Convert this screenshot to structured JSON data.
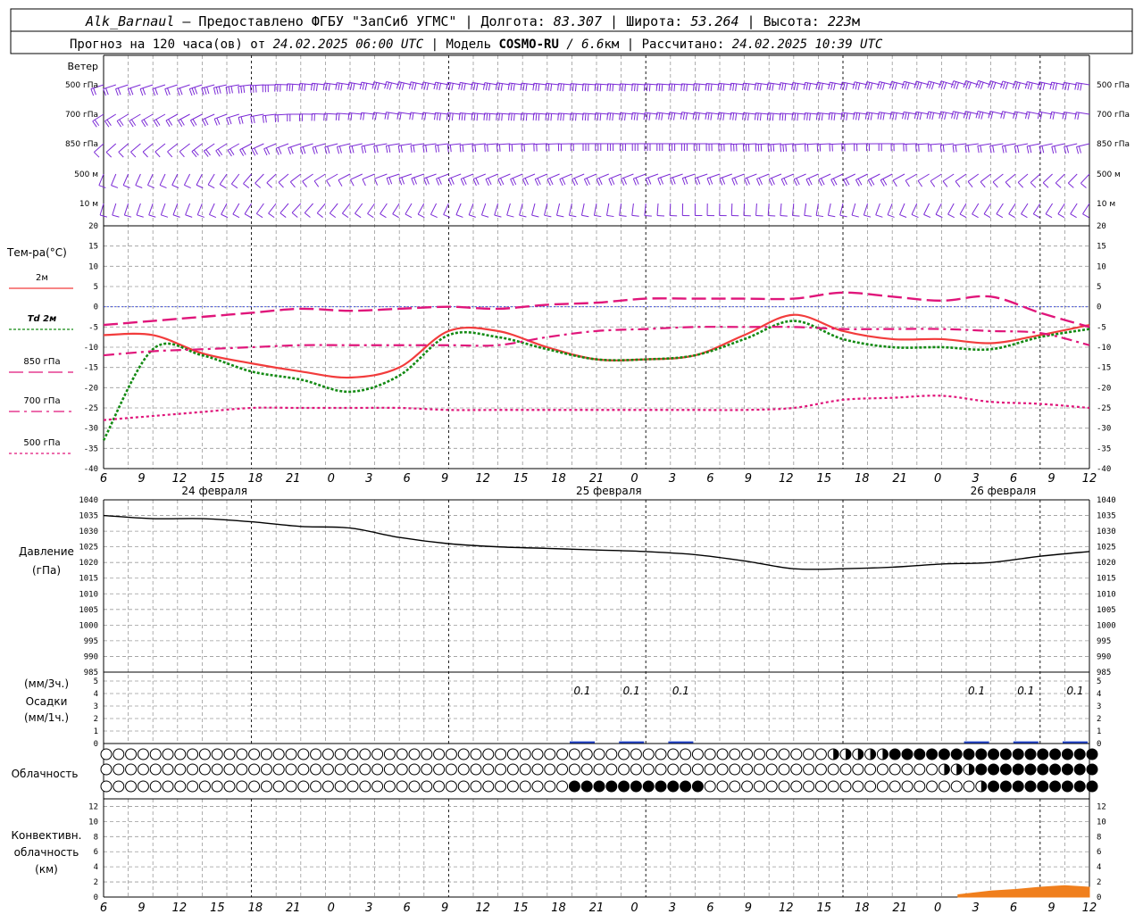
{
  "header": {
    "station": "Alk_Barnaul",
    "provider": " — Предоставлено ФГБУ \"ЗапСиб УГМС\" | Долгота: ",
    "lon": "83.307",
    "lat_label": " | Широта: ",
    "lat": "53.264",
    "alt_label": " | Высота: ",
    "alt": "223",
    "alt_unit": "м",
    "line2_a": "Прогноз на 120 часа(ов) от ",
    "forecast_start": "24.02.2025 06:00 UTC",
    "line2_b": " | Модель ",
    "model": "COSMO-RU",
    "model_res": " / 6.6",
    "model_res_unit": "км",
    "line2_c": " | Рассчитано: ",
    "calc_time": "24.02.2025 10:39 UTC"
  },
  "labels": {
    "wind": "Ветер",
    "wind_levels": [
      "500 гПа",
      "700 гПа",
      "850 гПа",
      "500 м",
      "10 м"
    ],
    "temp_title": "Тем-ра(°C)",
    "temp_legend": [
      "2м",
      "Td 2м",
      "850 гПа",
      "700 гПа",
      "500 гПа"
    ],
    "pressure_title": "Давление",
    "pressure_unit": "(гПа)",
    "precip_top": "(мм/3ч.)",
    "precip_title": "Осадки",
    "precip_bottom": "(мм/1ч.)",
    "cloud_title": "Облачность",
    "conv_title": [
      "Конвективн.",
      "облачность",
      "(км)"
    ]
  },
  "colors": {
    "wind": "#7b2ad6",
    "t2m": "#f23c3c",
    "td2m": "#138a13",
    "t850": "#e0157a",
    "t700": "#e0157a",
    "t500": "#e0157a",
    "pressure": "#000000",
    "precip": "#2244cc",
    "conv": "#f07f1d",
    "zero_line": "#3344dd"
  },
  "chart_data": [
    {
      "type": "wind_barbs",
      "levels": [
        "500 гПа",
        "700 гПа",
        "850 гПа",
        "500 м",
        "10 м"
      ],
      "x_hours": [
        0,
        12,
        24,
        36,
        48,
        60,
        72,
        84,
        96,
        108,
        120
      ],
      "direction_deg": [
        [
          250,
          250,
          275,
          285,
          280,
          275,
          275,
          280,
          285,
          290,
          280
        ],
        [
          235,
          240,
          270,
          280,
          275,
          275,
          280,
          275,
          280,
          285,
          280
        ],
        [
          225,
          230,
          250,
          260,
          265,
          270,
          270,
          265,
          270,
          260,
          255
        ],
        [
          200,
          205,
          230,
          250,
          245,
          245,
          250,
          245,
          240,
          230,
          220
        ],
        [
          195,
          200,
          220,
          210,
          195,
          190,
          180,
          185,
          200,
          210,
          210
        ]
      ],
      "speed_ms": [
        [
          18,
          20,
          22,
          25,
          28,
          28,
          30,
          30,
          28,
          26,
          24
        ],
        [
          12,
          14,
          16,
          18,
          22,
          24,
          26,
          24,
          22,
          20,
          18
        ],
        [
          10,
          12,
          14,
          16,
          18,
          20,
          22,
          20,
          18,
          16,
          14
        ],
        [
          8,
          9,
          10,
          12,
          14,
          16,
          16,
          14,
          12,
          10,
          9
        ],
        [
          4,
          5,
          5,
          6,
          6,
          7,
          7,
          6,
          5,
          5,
          4
        ]
      ]
    },
    {
      "type": "line",
      "title": "Тем-ра(°C)",
      "ylim": [
        -40,
        20
      ],
      "yticks": [
        20,
        15,
        10,
        5,
        0,
        -5,
        -10,
        -15,
        -20,
        -25,
        -30,
        -35,
        -40
      ],
      "x_hours": [
        0,
        6,
        12,
        18,
        24,
        30,
        36,
        42,
        48,
        54,
        60,
        66,
        72,
        78,
        84,
        90,
        96,
        102,
        108,
        114,
        120
      ],
      "series": [
        {
          "name": "2м",
          "values": [
            -7,
            -7,
            -11.5,
            -14,
            -16,
            -17.5,
            -15,
            -6,
            -6,
            -10,
            -13,
            -13,
            -12,
            -7,
            -2,
            -6,
            -8,
            -8,
            -9,
            -7,
            -4.5
          ]
        },
        {
          "name": "Td 2м",
          "values": [
            -33,
            -10.5,
            -12,
            -16,
            -18,
            -21,
            -17,
            -7,
            -7.5,
            -10.5,
            -13,
            -13,
            -12,
            -8,
            -3.5,
            -8,
            -10,
            -10,
            -10.5,
            -7.5,
            -5.5
          ]
        },
        {
          "name": "850 гПа",
          "values": [
            -4.5,
            -3.5,
            -2.5,
            -1.5,
            -0.5,
            -1,
            -0.5,
            0,
            -0.5,
            0.5,
            1,
            2,
            2,
            2,
            2,
            3.5,
            2.5,
            1.5,
            2.5,
            -1.5,
            -5
          ]
        },
        {
          "name": "700 гПа",
          "values": [
            -12,
            -11,
            -10.5,
            -10,
            -9.5,
            -9.5,
            -9.5,
            -9.5,
            -9.5,
            -7.5,
            -6,
            -5.5,
            -5,
            -5,
            -5,
            -5.5,
            -5.5,
            -5.5,
            -6,
            -6.5,
            -9.5
          ]
        },
        {
          "name": "500 гПа",
          "values": [
            -28,
            -27,
            -26,
            -25,
            -25,
            -25,
            -25,
            -25.5,
            -25.5,
            -25.5,
            -25.5,
            -25.5,
            -25.5,
            -25.5,
            -25,
            -23,
            -22.5,
            -22,
            -23.5,
            -24,
            -25
          ]
        }
      ]
    },
    {
      "type": "line",
      "title": "Давление",
      "ylim": [
        985,
        1040
      ],
      "yticks": [
        1040,
        1035,
        1030,
        1025,
        1020,
        1015,
        1010,
        1005,
        1000,
        995,
        990,
        985
      ],
      "x_hours": [
        0,
        6,
        12,
        18,
        24,
        30,
        36,
        42,
        48,
        54,
        60,
        66,
        72,
        78,
        84,
        90,
        96,
        102,
        108,
        114,
        120
      ],
      "series": [
        {
          "name": "",
          "values": [
            1035,
            1034,
            1034,
            1033,
            1031.5,
            1031,
            1028,
            1026,
            1025,
            1024.5,
            1024,
            1023.5,
            1022.5,
            1020.5,
            1018,
            1018,
            1018.5,
            1019.5,
            1020,
            1022,
            1023.5
          ]
        }
      ]
    },
    {
      "type": "bar",
      "title": "Осадки",
      "ylim": [
        0,
        5
      ],
      "yticks": [
        5,
        4,
        3,
        2,
        1,
        0
      ],
      "x_hours": [
        60,
        66,
        72,
        108,
        114,
        120
      ],
      "values": [
        0.1,
        0.1,
        0.1,
        0.1,
        0.1,
        0.1
      ],
      "labels": [
        "0.1",
        "0.1",
        "0.1",
        "0.1",
        "0.1",
        "0.1"
      ]
    },
    {
      "type": "table",
      "title": "Облачность",
      "rows_levels": [
        "high",
        "middle",
        "low"
      ],
      "hours_step": 1.5,
      "cloud_fraction_rows": [
        {
          "start": 0,
          "end": 88,
          "value": 0,
          "then": [
            [
              88,
              95,
              0.5
            ],
            [
              95,
              120,
              1
            ]
          ]
        },
        {
          "start": 0,
          "end": 102,
          "value": 0,
          "then": [
            [
              102,
              106,
              0.6
            ],
            [
              106,
              120,
              1
            ]
          ]
        },
        {
          "start": 0,
          "end": 57,
          "value": 0,
          "then": [
            [
              57,
              73,
              1
            ],
            [
              73,
              106,
              0
            ],
            [
              106,
              108,
              0.3
            ],
            [
              108,
              120,
              1
            ]
          ]
        }
      ]
    },
    {
      "type": "area",
      "title": "Конвективн. облачность (км)",
      "ylim": [
        0,
        13
      ],
      "yticks": [
        12,
        10,
        8,
        6,
        4,
        2,
        0
      ],
      "x_hours": [
        104,
        108,
        111,
        114,
        117,
        120
      ],
      "values": [
        0.3,
        0.8,
        1.0,
        1.3,
        1.5,
        1.3
      ]
    }
  ],
  "x_axis": {
    "hour_labels": [
      "6",
      "9",
      "12",
      "15",
      "18",
      "21",
      "0",
      "3",
      "6",
      "9",
      "12",
      "15",
      "18",
      "21",
      "0",
      "3",
      "6",
      "9",
      "12",
      "15",
      "18",
      "21",
      "0",
      "3",
      "6",
      "9",
      "12"
    ],
    "date_labels": [
      "24 февраля",
      "25 февраля",
      "26 февраля"
    ]
  }
}
